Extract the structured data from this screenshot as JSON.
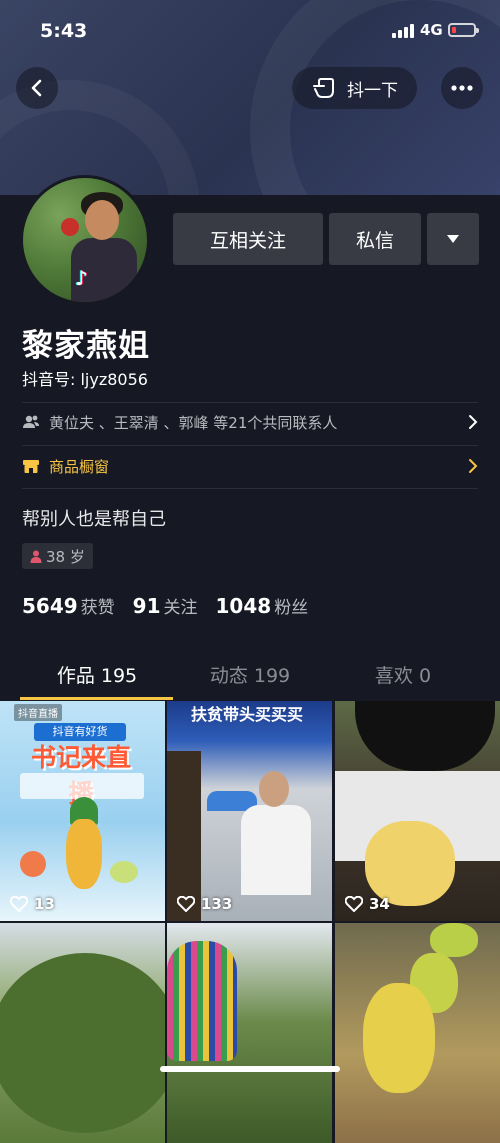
{
  "status_bar": {
    "time": "5:43",
    "network": "4G",
    "battery_level": 0.15,
    "battery_color": "#ff4444"
  },
  "top_bar": {
    "back_icon": "chevron-left-icon",
    "shake_label": "抖一下",
    "shake_icon": "hand-pointer-icon",
    "more_icon": "more-dots-icon"
  },
  "profile": {
    "nickname": "黎家燕姐",
    "douyin_id": "抖音号: ljyz8056",
    "contacts_text": "黄位夫 、王翠清 、郭峰 等21个共同联系人",
    "shop_text": "商品橱窗",
    "bio": "帮别人也是帮自己",
    "age": "38 岁"
  },
  "actions": {
    "follow_label": "互相关注",
    "message_label": "私信"
  },
  "stats": [
    {
      "num": "5649",
      "label": "获赞"
    },
    {
      "num": "91",
      "label": "关注"
    },
    {
      "num": "1048",
      "label": "粉丝"
    }
  ],
  "tabs": [
    {
      "label": "作品 195",
      "active": true
    },
    {
      "label": "动态 199",
      "active": false
    },
    {
      "label": "喜欢 0",
      "active": false
    }
  ],
  "videos": [
    {
      "likes": "13",
      "cover_badge": "抖音有好货",
      "cover_title": "书记来直播",
      "corner_text": "抖音直播"
    },
    {
      "likes": "133",
      "cover_title": "扶贫带头买买买"
    },
    {
      "likes": "34"
    },
    {
      "likes": ""
    },
    {
      "likes": ""
    },
    {
      "likes": ""
    }
  ],
  "colors": {
    "background": "#161823",
    "accent": "#f7c543",
    "button": "#393b44",
    "secondary_text": "#b9bac0",
    "age_icon": "#e0566c"
  }
}
